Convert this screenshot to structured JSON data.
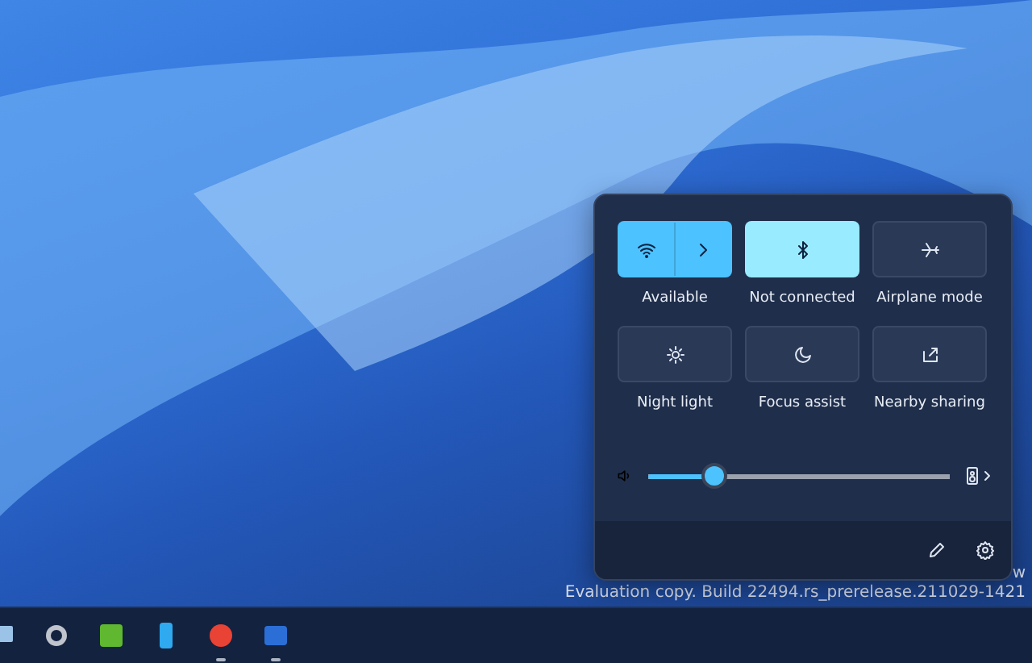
{
  "quick_settings": {
    "tiles": [
      {
        "label": "Available",
        "kind": "split",
        "on": true
      },
      {
        "label": "Not connected",
        "kind": "single",
        "on": true
      },
      {
        "label": "Airplane mode",
        "kind": "single",
        "on": false
      },
      {
        "label": "Night light",
        "kind": "single",
        "on": false
      },
      {
        "label": "Focus assist",
        "kind": "single",
        "on": false
      },
      {
        "label": "Nearby sharing",
        "kind": "single",
        "on": false
      }
    ],
    "volume": {
      "level": 0.22
    }
  },
  "desktop_watermark": {
    "line_1": "w",
    "line_2": "Evaluation copy. Build 22494.rs_prerelease.211029-1421"
  },
  "taskbar": {
    "apps": [
      {
        "running": false
      },
      {
        "running": false
      },
      {
        "running": false
      },
      {
        "running": false
      },
      {
        "running": true
      },
      {
        "running": true
      }
    ]
  }
}
